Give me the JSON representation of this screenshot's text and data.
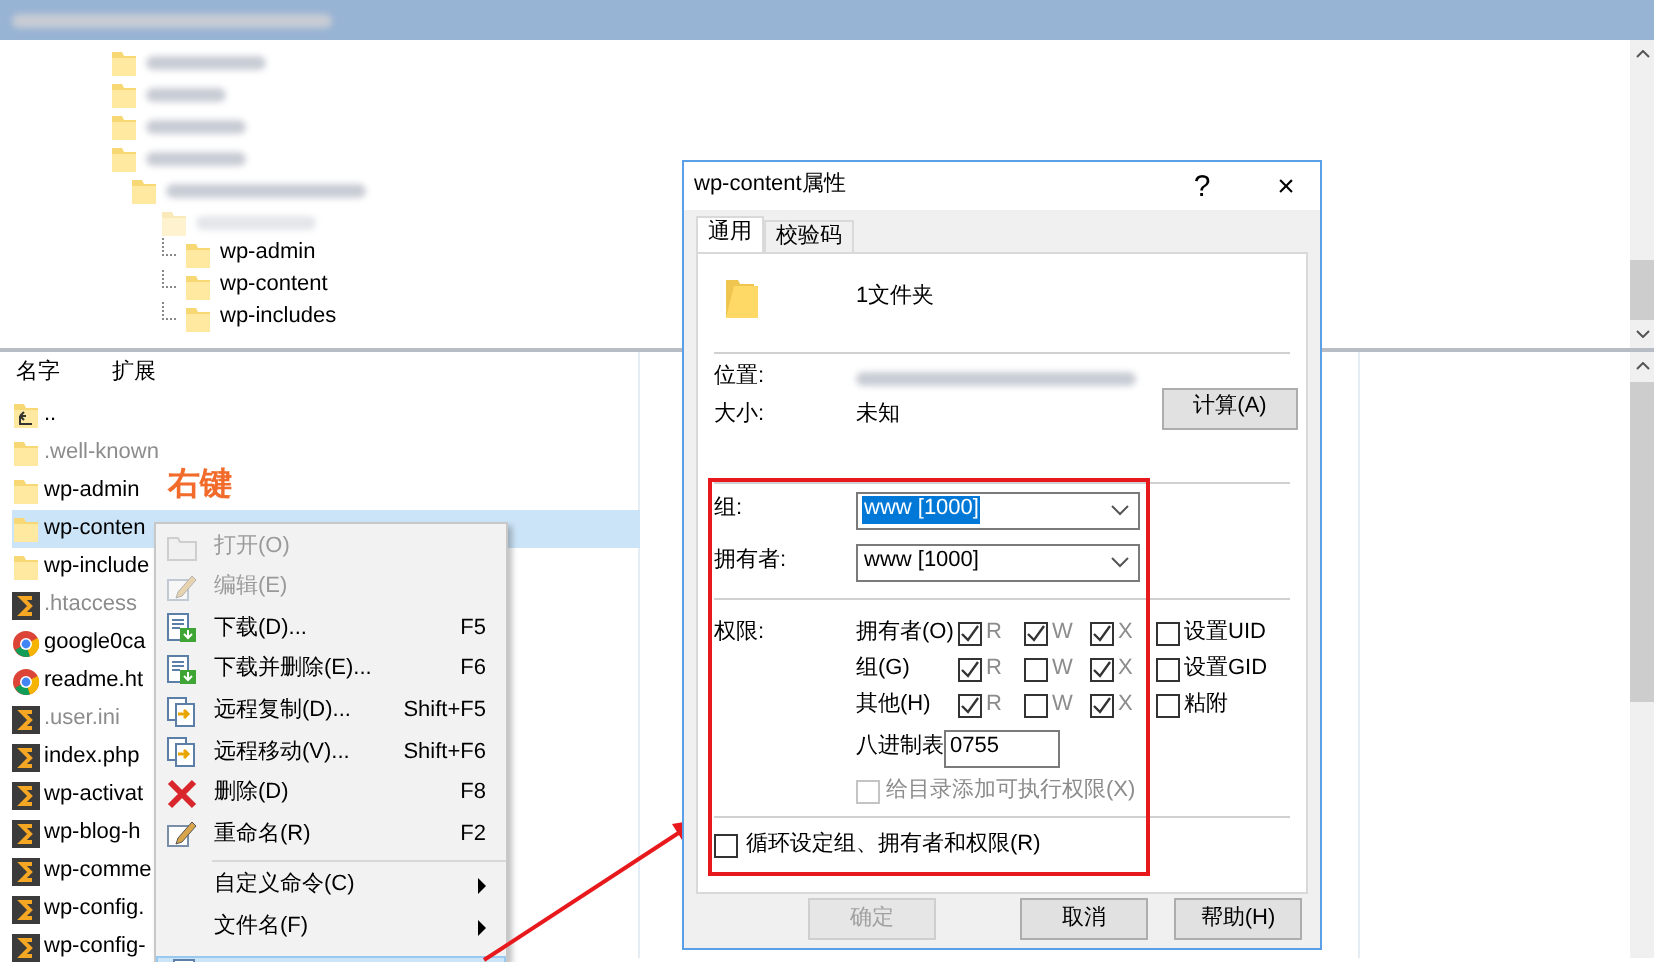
{
  "tree": {
    "items": [
      {
        "label": "wp-admin"
      },
      {
        "label": "wp-content"
      },
      {
        "label": "wp-includes"
      }
    ]
  },
  "file_list": {
    "columns": [
      "名字",
      "扩展"
    ],
    "rows": [
      {
        "name": "..",
        "kind": "parent",
        "dimmed": false,
        "selected": false
      },
      {
        "name": ".well-known",
        "kind": "folder",
        "dimmed": true,
        "selected": false
      },
      {
        "name": "wp-admin",
        "kind": "folder",
        "dimmed": false,
        "selected": false
      },
      {
        "name": "wp-conten",
        "kind": "folder",
        "dimmed": false,
        "selected": true
      },
      {
        "name": "wp-include",
        "kind": "folder",
        "dimmed": false,
        "selected": false
      },
      {
        "name": ".htaccess",
        "kind": "script",
        "dimmed": true,
        "selected": false
      },
      {
        "name": "google0ca",
        "kind": "browser",
        "dimmed": false,
        "selected": false
      },
      {
        "name": "readme.ht",
        "kind": "browser",
        "dimmed": false,
        "selected": false
      },
      {
        "name": ".user.ini",
        "kind": "script",
        "dimmed": true,
        "selected": false
      },
      {
        "name": "index.php",
        "kind": "script",
        "dimmed": false,
        "selected": false
      },
      {
        "name": "wp-activat",
        "kind": "script",
        "dimmed": false,
        "selected": false
      },
      {
        "name": "wp-blog-h",
        "kind": "script",
        "dimmed": false,
        "selected": false
      },
      {
        "name": "wp-comme",
        "kind": "script",
        "dimmed": false,
        "selected": false
      },
      {
        "name": "wp-config.",
        "kind": "script",
        "dimmed": false,
        "selected": false
      },
      {
        "name": "wp-config-",
        "kind": "script",
        "dimmed": false,
        "selected": false
      }
    ]
  },
  "annotation": "右键",
  "context_menu": {
    "items": [
      {
        "kind": "item",
        "label": "打开(O)",
        "disabled": true
      },
      {
        "kind": "item",
        "label": "编辑(E)",
        "disabled": true
      },
      {
        "kind": "item",
        "label": "下载(D)...",
        "shortcut": "F5",
        "disabled": false
      },
      {
        "kind": "item",
        "label": "下载并删除(E)...",
        "shortcut": "F6",
        "disabled": false
      },
      {
        "kind": "item",
        "label": "远程复制(D)...",
        "shortcut": "Shift+F5",
        "disabled": false
      },
      {
        "kind": "item",
        "label": "远程移动(V)...",
        "shortcut": "Shift+F6",
        "disabled": false
      },
      {
        "kind": "item",
        "label": "删除(D)",
        "shortcut": "F8",
        "disabled": false
      },
      {
        "kind": "item",
        "label": "重命名(R)",
        "shortcut": "F2",
        "disabled": false
      },
      {
        "kind": "separator"
      },
      {
        "kind": "submenu",
        "label": "自定义命令(C)",
        "disabled": false
      },
      {
        "kind": "submenu",
        "label": "文件名(F)",
        "disabled": false
      },
      {
        "kind": "cut",
        "selected": true
      }
    ]
  },
  "dialog": {
    "title": "wp-content属性",
    "help": "?",
    "close": "×",
    "tabs": [
      {
        "label": "通用",
        "selected": true
      },
      {
        "label": "校验码",
        "selected": false
      }
    ],
    "summary": "1文件夹",
    "location_label": "位置:",
    "size_label": "大小:",
    "size_value": "未知",
    "calc_button": "计算(A)",
    "group": {
      "label": "组:",
      "value": "www [1000]",
      "selected": true
    },
    "owner": {
      "label": "拥有者:",
      "value": "www [1000]",
      "selected": false
    },
    "permissions_label": "权限:",
    "permissions": [
      {
        "label": "拥有者(O)",
        "flags": [
          {
            "label": "R",
            "checked": true
          },
          {
            "label": "W",
            "checked": true
          },
          {
            "label": "X",
            "checked": true
          }
        ],
        "special": "设置UID",
        "special_checked": false
      },
      {
        "label": "组(G)",
        "flags": [
          {
            "label": "R",
            "checked": true
          },
          {
            "label": "W",
            "checked": false
          },
          {
            "label": "X",
            "checked": true
          }
        ],
        "special": "设置GID",
        "special_checked": false
      },
      {
        "label": "其他(H)",
        "flags": [
          {
            "label": "R",
            "checked": true
          },
          {
            "label": "W",
            "checked": false
          },
          {
            "label": "X",
            "checked": true
          }
        ],
        "special": "粘附",
        "special_checked": false
      }
    ],
    "octal_label": "八进制表",
    "octal_value": "0755",
    "exec_option": {
      "label": "给目录添加可执行权限(X)",
      "checked": false,
      "disabled": true
    },
    "recursive_option": {
      "label": "循环设定组、拥有者和权限(R)",
      "checked": false
    },
    "buttons": [
      {
        "label": "确定",
        "disabled": true
      },
      {
        "label": "取消",
        "disabled": false
      },
      {
        "label": "帮助(H)",
        "disabled": false
      }
    ]
  }
}
